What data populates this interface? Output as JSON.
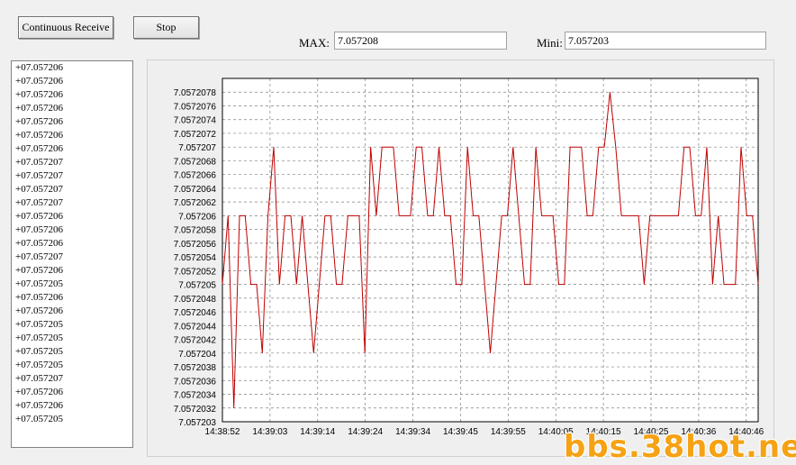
{
  "toolbar": {
    "continuous_receive_label": "Continuous Receive",
    "stop_label": "Stop"
  },
  "stats": {
    "max_label": "MAX:",
    "max_value": "7.057208",
    "mini_label": "Mini:",
    "mini_value": "7.057203"
  },
  "readings": [
    "+07.057206",
    "+07.057206",
    "+07.057206",
    "+07.057206",
    "+07.057206",
    "+07.057206",
    "+07.057206",
    "+07.057207",
    "+07.057207",
    "+07.057207",
    "+07.057207",
    "+07.057206",
    "+07.057206",
    "+07.057206",
    "+07.057207",
    "+07.057206",
    "+07.057205",
    "+07.057206",
    "+07.057206",
    "+07.057205",
    "+07.057205",
    "+07.057205",
    "+07.057205",
    "+07.057207",
    "+07.057206",
    "+07.057206",
    "+07.057205"
  ],
  "chart_data": {
    "type": "line",
    "ylim": [
      7.057203,
      7.057208
    ],
    "y_ticks": [
      "7.057203",
      "7.0572032",
      "7.0572034",
      "7.0572036",
      "7.0572038",
      "7.057204",
      "7.0572042",
      "7.0572044",
      "7.0572046",
      "7.0572048",
      "7.057205",
      "7.0572052",
      "7.0572054",
      "7.0572056",
      "7.0572058",
      "7.057206",
      "7.0572062",
      "7.0572064",
      "7.0572066",
      "7.0572068",
      "7.057207",
      "7.0572072",
      "7.0572074",
      "7.0572076",
      "7.0572078"
    ],
    "x_ticks": [
      "14:38:52",
      "14:39:03",
      "14:39:14",
      "14:39:24",
      "14:39:34",
      "14:39:45",
      "14:39:55",
      "14:40:05",
      "14:40:15",
      "14:40:25",
      "14:40:36",
      "14:40:46"
    ],
    "grid": true,
    "line_color": "#c00000",
    "series": [
      {
        "values": [
          7.057205,
          7.057206,
          7.0572032,
          7.057206,
          7.057206,
          7.057205,
          7.057205,
          7.057204,
          7.057206,
          7.057207,
          7.057205,
          7.057206,
          7.057206,
          7.057205,
          7.057206,
          7.057205,
          7.057204,
          7.057205,
          7.057206,
          7.057206,
          7.057205,
          7.057205,
          7.057206,
          7.057206,
          7.057206,
          7.057204,
          7.057207,
          7.057206,
          7.057207,
          7.057207,
          7.057207,
          7.057206,
          7.057206,
          7.057206,
          7.057207,
          7.057207,
          7.057206,
          7.057206,
          7.057207,
          7.057206,
          7.057206,
          7.057205,
          7.057205,
          7.057207,
          7.057206,
          7.057206,
          7.057205,
          7.057204,
          7.057205,
          7.057206,
          7.057206,
          7.057207,
          7.057206,
          7.057205,
          7.057205,
          7.057207,
          7.057206,
          7.057206,
          7.057206,
          7.057205,
          7.057205,
          7.057207,
          7.057207,
          7.057207,
          7.057206,
          7.057206,
          7.057207,
          7.057207,
          7.0572078,
          7.057207,
          7.057206,
          7.057206,
          7.057206,
          7.057206,
          7.057205,
          7.057206,
          7.057206,
          7.057206,
          7.057206,
          7.057206,
          7.057206,
          7.057207,
          7.057207,
          7.057206,
          7.057206,
          7.057207,
          7.057205,
          7.057206,
          7.057205,
          7.057205,
          7.057205,
          7.057207,
          7.057206,
          7.057206,
          7.057205
        ]
      }
    ]
  }
}
